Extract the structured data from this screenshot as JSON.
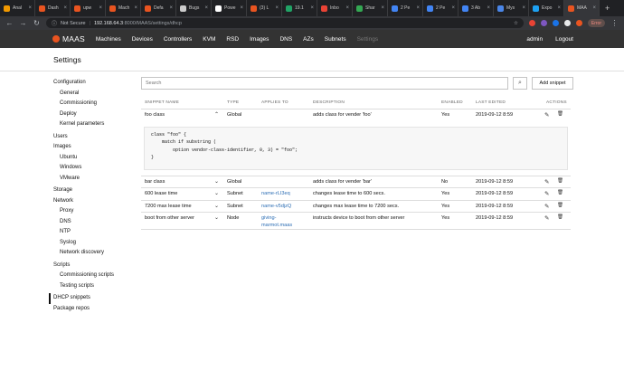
{
  "browser": {
    "tabs": [
      {
        "label": "Anal",
        "color": "#f29900"
      },
      {
        "label": "Dash",
        "color": "#e95420"
      },
      {
        "label": "upw",
        "color": "#e95420"
      },
      {
        "label": "Mach",
        "color": "#e95420"
      },
      {
        "label": "Defa",
        "color": "#e95420"
      },
      {
        "label": "Bugs",
        "color": "#cccccc"
      },
      {
        "label": "Powe",
        "color": "#ffffff"
      },
      {
        "label": "(3) L",
        "color": "#e95420"
      },
      {
        "label": "19.1",
        "color": "#21a366"
      },
      {
        "label": "Inbo",
        "color": "#ea4335"
      },
      {
        "label": "Shar",
        "color": "#34a853"
      },
      {
        "label": "2 Pe",
        "color": "#4285f4"
      },
      {
        "label": "2 Pe",
        "color": "#4285f4"
      },
      {
        "label": "3 Ab",
        "color": "#4285f4"
      },
      {
        "label": "Mys",
        "color": "#4a86e8"
      },
      {
        "label": "Expo",
        "color": "#1da1f2"
      },
      {
        "label": "MAA",
        "color": "#e95420"
      }
    ],
    "close_glyph": "×",
    "new_tab": "+",
    "not_secure": "Not Secure",
    "url_host": "192.168.64.3",
    "url_path": ":8000/MAAS/settings/dhcp",
    "error_badge": "Error"
  },
  "header": {
    "logo": "MAAS",
    "nav": [
      "Machines",
      "Devices",
      "Controllers",
      "KVM",
      "RSD",
      "Images",
      "DNS",
      "AZs",
      "Subnets"
    ],
    "nav_muted": "Settings",
    "user": "admin",
    "logout": "Logout"
  },
  "page": {
    "title": "Settings"
  },
  "sidebar": {
    "configuration": "Configuration",
    "general": "General",
    "commissioning": "Commissioning",
    "deploy": "Deploy",
    "kernel_parameters": "Kernel parameters",
    "users": "Users",
    "images": "Images",
    "ubuntu": "Ubuntu",
    "windows": "Windows",
    "vmware": "VMware",
    "storage": "Storage",
    "network": "Network",
    "proxy": "Proxy",
    "dns": "DNS",
    "ntp": "NTP",
    "syslog": "Syslog",
    "network_discovery": "Network discovery",
    "scripts": "Scripts",
    "commissioning_scripts": "Commissioning scripts",
    "testing_scripts": "Testing scripts",
    "dhcp_snippets": "DHCP snippets",
    "package_repos": "Package repos"
  },
  "main": {
    "search_placeholder": "Search",
    "add_snippet": "Add snippet",
    "columns": {
      "name": "SNIPPET NAME",
      "type": "TYPE",
      "applies_to": "APPLIES TO",
      "description": "DESCRIPTION",
      "enabled": "ENABLED",
      "last_edited": "LAST EDITED",
      "actions": "ACTIONS"
    },
    "rows": [
      {
        "name": "foo class",
        "type": "Global",
        "applies": "",
        "applies2": "",
        "description": "adds class for vender 'foo'",
        "enabled": "Yes",
        "edited": "2019-09-12 8:59"
      },
      {
        "name": "bar class",
        "type": "Global",
        "applies": "",
        "applies2": "",
        "description": "adds class for vender 'bar'",
        "enabled": "No",
        "edited": "2019-09-12 8:59"
      },
      {
        "name": "600 lease time",
        "type": "Subnet",
        "applies": "name-rLI3eq",
        "applies2": "",
        "description": "changes lease time to 600 secs.",
        "enabled": "Yes",
        "edited": "2019-09-12 8:59"
      },
      {
        "name": "7200 max lease time",
        "type": "Subnet",
        "applies": "name-v5djzQ",
        "applies2": "",
        "description": "changes max lease time to 7200 secs.",
        "enabled": "Yes",
        "edited": "2019-09-12 8:59"
      },
      {
        "name": "boot from other server",
        "type": "Node",
        "applies": "giving-",
        "applies2": "marmot.maas",
        "description": "instructs device to boot from other server",
        "enabled": "Yes",
        "edited": "2019-09-12 8:59"
      }
    ],
    "code": "class \"foo\" {\n    match if substring (\n        option vendor-class-identifier, 0, 3) = \"foo\";\n}"
  },
  "icons": {
    "back": "←",
    "forward": "→",
    "reload": "↻",
    "search": "⌕",
    "chevron_up": "⌃",
    "chevron_down": "⌄",
    "edit": "✎",
    "delete": "🗑",
    "star": "☆"
  }
}
